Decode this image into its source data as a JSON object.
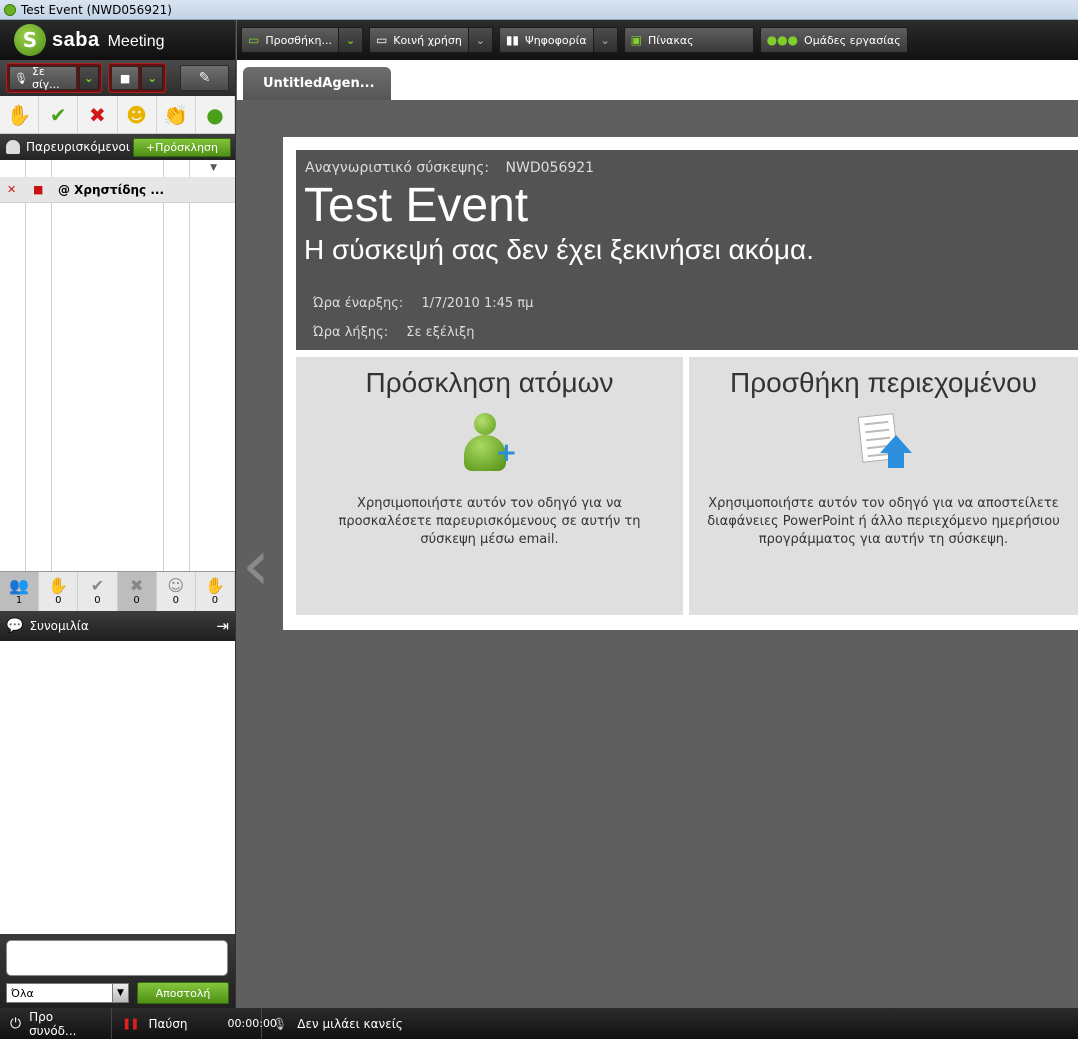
{
  "window": {
    "title": "Test Event (NWD056921)"
  },
  "logo": {
    "brand": "saba",
    "product": "Meeting"
  },
  "av": {
    "mic_label": "Σε σίγ...",
    "cam_label": ""
  },
  "attendees": {
    "header": "Παρευρισκόμενοι",
    "invite_button": "+Πρόσκληση",
    "rows": [
      {
        "name": "@ Χρηστίδης ..."
      }
    ]
  },
  "counts": [
    "1",
    "0",
    "0",
    "0",
    "0",
    "0"
  ],
  "chat": {
    "header": "Συνομιλία",
    "recipient": "Όλα",
    "send_button": "Αποστολή"
  },
  "toolbar": {
    "add": "Προσθήκη...",
    "share": "Κοινή χρήση",
    "poll": "Ψηφοφορία",
    "whiteboard": "Πίνακας",
    "breakout": "Ομάδες εργασίας"
  },
  "tab": {
    "label": "UntitledAgen..."
  },
  "meeting": {
    "id_label": "Αναγνωριστικό σύσκεψης:",
    "id_value": "NWD056921",
    "title": "Test Event",
    "status": "Η σύσκεψή σας δεν έχει ξεκινήσει ακόμα.",
    "start_label": "Ώρα έναρξης:",
    "start_value": "1/7/2010 1:45 πμ",
    "end_label": "Ώρα λήξης:",
    "end_value": "Σε εξέλιξη"
  },
  "cards": {
    "invite": {
      "title": "Πρόσκληση ατόμων",
      "text": "Χρησιμοποιήστε αυτόν τον οδηγό για να προσκαλέσετε παρευρισκόμενους σε αυτήν τη σύσκεψη μέσω email."
    },
    "content": {
      "title": "Προσθήκη περιεχομένου",
      "text": "Χρησιμοποιήστε αυτόν τον οδηγό για να αποστείλετε διαφάνειες PowerPoint ή άλλο περιεχόμενο ημερήσιου προγράμματος για αυτήν τη σύσκεψη."
    }
  },
  "statusbar": {
    "meeting": "Προ συνόδ...",
    "pause": "Παύση",
    "timer": "00:00:00",
    "speaker": "Δεν μιλάει κανείς"
  }
}
